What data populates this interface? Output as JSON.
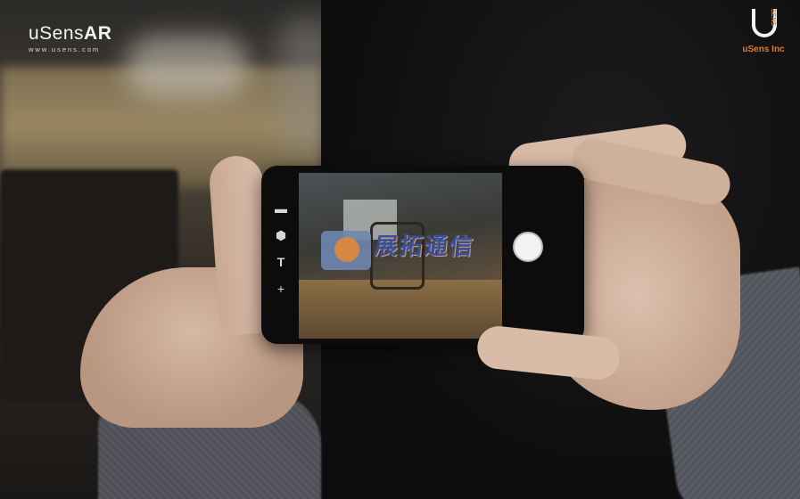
{
  "logos": {
    "left_brand_prefix": "uSens",
    "left_brand_suffix": "AR",
    "left_url": "www.usens.com",
    "right_letters": "SENS",
    "right_name": "uSens Inc"
  },
  "phone": {
    "ar_overlay_text": "展拓通信",
    "tools": [
      "▬",
      "⬢",
      "T",
      "+"
    ]
  },
  "colors": {
    "accent_orange": "#e07a2a",
    "logo_white": "#f4f4f4"
  }
}
